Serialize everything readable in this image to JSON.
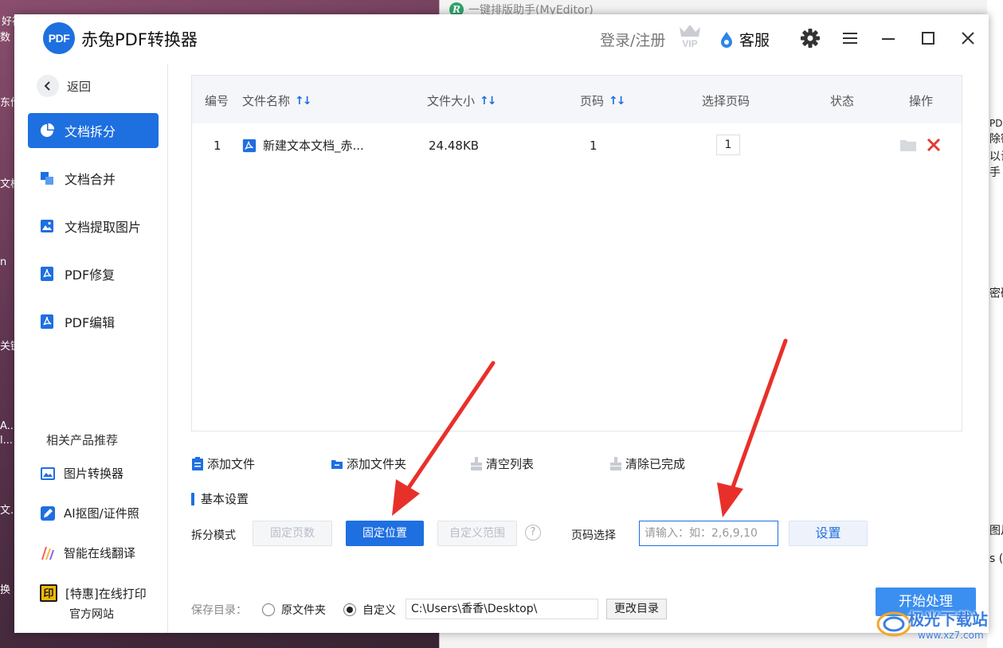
{
  "background_window": {
    "title": "一键排版助手(MyEditor)",
    "side_texts": [
      "PDF",
      "除密",
      "以设",
      "手",
      "密码",
      "图片",
      "s (S"
    ]
  },
  "desktop": {
    "texts": [
      "好视",
      "数",
      "东伦",
      "文档",
      "n",
      "关键",
      "A...",
      "l...",
      "文...",
      "换"
    ]
  },
  "app": {
    "title": "赤兔PDF转换器",
    "logo_text": "PDF",
    "login": "登录/注册",
    "vip": "VIP",
    "service": "客服"
  },
  "sidebar": {
    "back": "返回",
    "nav": [
      {
        "label": "文档拆分",
        "active": true
      },
      {
        "label": "文档合并",
        "active": false
      },
      {
        "label": "文档提取图片",
        "active": false
      },
      {
        "label": "PDF修复",
        "active": false
      },
      {
        "label": "PDF编辑",
        "active": false
      }
    ],
    "recommend_title": "相关产品推荐",
    "recommend": [
      "图片转换器",
      "AI抠图/证件照",
      "智能在线翻译",
      "[特惠]在线打印"
    ],
    "official_site": "官方网站"
  },
  "table": {
    "headers": [
      "编号",
      "文件名称",
      "文件大小",
      "页码",
      "选择页码",
      "状态",
      "操作"
    ],
    "rows": [
      {
        "no": "1",
        "name": "新建文本文档_赤...",
        "size": "24.48KB",
        "pages": "1",
        "selected": "1",
        "status": ""
      }
    ]
  },
  "toolbar": {
    "add_file": "添加文件",
    "add_folder": "添加文件夹",
    "clear_list": "清空列表",
    "clear_done": "清除已完成"
  },
  "settings": {
    "title": "基本设置",
    "split_mode_label": "拆分模式",
    "modes": [
      {
        "label": "固定页数",
        "active": false
      },
      {
        "label": "固定位置",
        "active": true
      },
      {
        "label": "自定义范围",
        "active": false
      }
    ],
    "help": "?",
    "page_select_label": "页码选择",
    "page_input_placeholder": "请输入：如：2,6,9,10",
    "set_button": "设置"
  },
  "save": {
    "label": "保存目录：",
    "options": [
      {
        "label": "原文件夹",
        "checked": false
      },
      {
        "label": "自定义",
        "checked": true
      }
    ],
    "path": "C:\\Users\\香香\\Desktop\\",
    "change_dir": "更改目录",
    "start": "开始处理"
  },
  "watermark": {
    "text": "极光下载站",
    "url": "www.xz7.com"
  },
  "colors": {
    "accent": "#1e6fe0",
    "arrow": "#e8302a",
    "delete": "#e53935"
  }
}
